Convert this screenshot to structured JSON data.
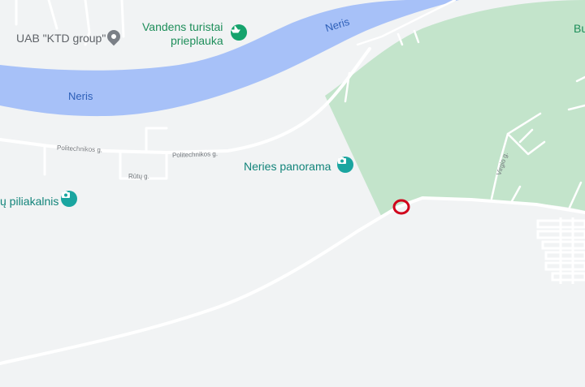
{
  "colors": {
    "land": "#f1f3f4",
    "water": "#a7c1f8",
    "park": "#c3e4cb",
    "road": "#ffffff",
    "marker": "#d0021b",
    "tourism_pin": "#15a36c",
    "photo_pin": "#1aa5a0",
    "generic_pin": "#7a7f86"
  },
  "labels": {
    "ktd": "UAB \"KTD group\"",
    "vandens_line1": "Vandens turistai",
    "vandens_line2": "prieplauka",
    "neris_upper": "Neris",
    "neris_lower": "Neris",
    "politechnikos_1": "Politechnikos g.",
    "politechnikos_2": "Politechnikos g.",
    "rutu": "Rūtų g.",
    "panorama": "Neries panorama",
    "piliakalnis": "ų piliakalnis",
    "virgio": "Virgio g.",
    "park_partial": "Bu"
  },
  "icons": {
    "ktd_pin": "map-pin-icon",
    "vandens_pin": "boat-icon",
    "panorama_pin": "camera-icon",
    "piliakalnis_pin": "camera-icon",
    "location_marker": "red-circle-marker"
  }
}
